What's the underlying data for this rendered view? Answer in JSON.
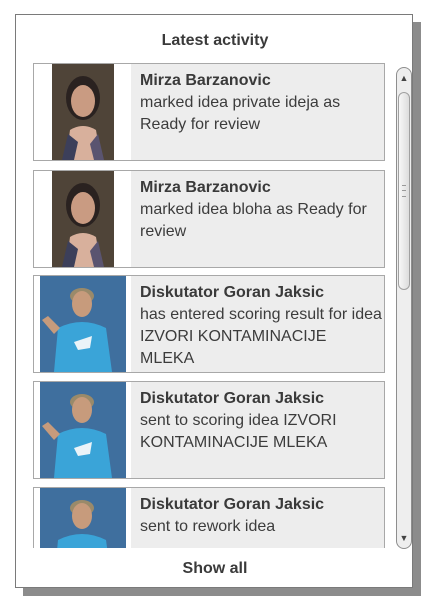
{
  "widget": {
    "title": "Latest activity",
    "show_all_label": "Show all"
  },
  "activities": [
    {
      "user": "Mirza Barzanovic",
      "text": "marked idea private ideja as Ready for review",
      "avatar": "woman-portrait"
    },
    {
      "user": "Mirza Barzanovic",
      "text": "marked idea bloha as Ready for review",
      "avatar": "woman-portrait"
    },
    {
      "user": "Diskutator Goran Jaksic",
      "text": "has entered scoring result for idea IZVORI KONTAMINACIJE MLEKA",
      "avatar": "man-blue-shirt"
    },
    {
      "user": "Diskutator Goran Jaksic",
      "text": "sent to scoring idea IZVORI KONTAMINACIJE MLEKA",
      "avatar": "man-blue-shirt"
    },
    {
      "user": "Diskutator Goran Jaksic",
      "text": "sent to rework idea",
      "avatar": "man-blue-shirt"
    }
  ],
  "colors": {
    "item_background": "#ededed",
    "shirt_blue": "#3aa4d8",
    "text": "#3c3c3c"
  }
}
